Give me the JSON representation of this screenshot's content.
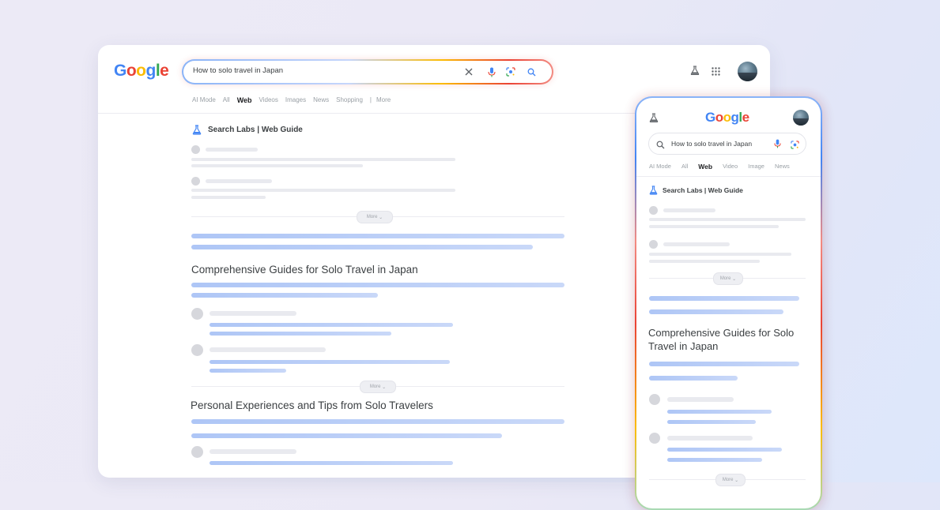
{
  "desktop": {
    "logo": [
      "G",
      "o",
      "o",
      "g",
      "l",
      "e"
    ],
    "search_query": "How to solo travel in Japan",
    "tabs": [
      "AI Mode",
      "All",
      "Web",
      "Videos",
      "Images",
      "News",
      "Shopping",
      "More"
    ],
    "active_tab": "Web",
    "labs_title": "Search Labs | Web Guide",
    "more_label": "More",
    "section1_heading": "Comprehensive Guides for Solo Travel in Japan",
    "section2_heading": "Personal Experiences and Tips from Solo Travelers"
  },
  "mobile": {
    "logo": [
      "G",
      "o",
      "o",
      "g",
      "l",
      "e"
    ],
    "search_query": "How to solo travel in Japan",
    "tabs": [
      "AI Mode",
      "All",
      "Web",
      "Video",
      "Image",
      "News"
    ],
    "active_tab": "Web",
    "labs_title": "Search Labs | Web Guide",
    "more_label": "More",
    "section1_heading": "Comprehensive Guides for Solo Travel in Japan"
  },
  "icons": [
    "clear-icon",
    "mic-icon",
    "lens-icon",
    "search-icon",
    "labs-flask-icon",
    "apps-grid-icon",
    "avatar"
  ],
  "colors": {
    "google_blue": "#4285f4",
    "google_red": "#ea4335",
    "google_yellow": "#fbbc05",
    "google_green": "#34a853"
  }
}
